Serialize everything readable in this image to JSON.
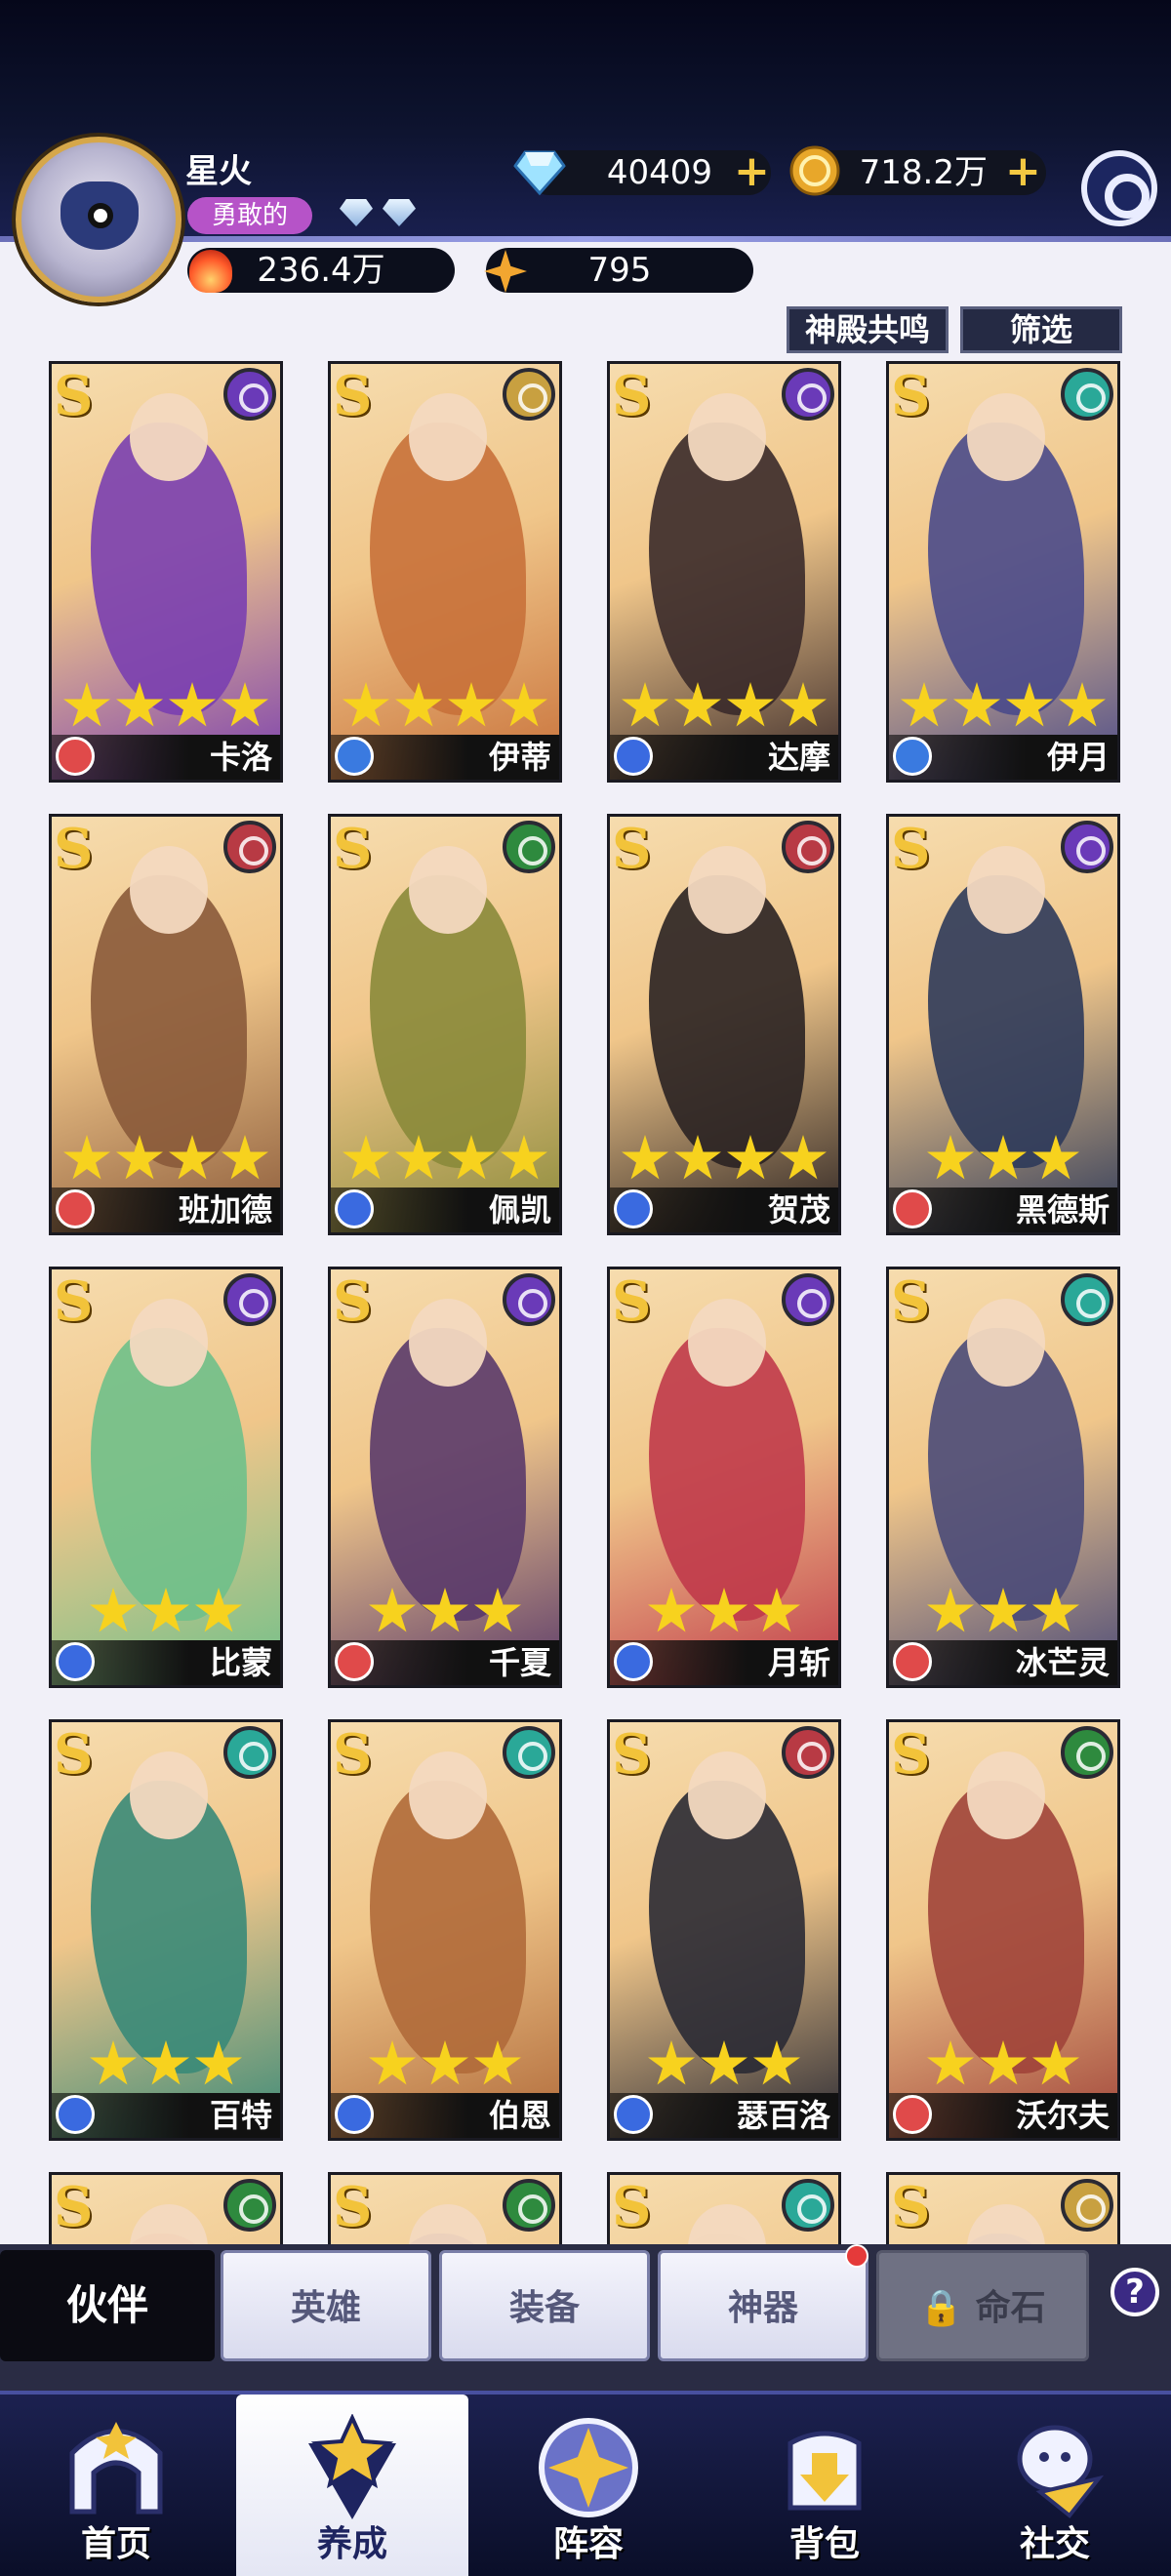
{
  "player": {
    "name": "星火",
    "title": "勇敢的",
    "power": "236.4万",
    "energy": "795"
  },
  "resources": {
    "diamonds": "40409",
    "gold": "718.2万"
  },
  "filters": {
    "resonance": "神殿共鸣",
    "filter": "筛选"
  },
  "heroes": [
    {
      "name": "卡洛",
      "stars": 4,
      "faction": "moon",
      "role": "sword",
      "color": "#7a3fb0"
    },
    {
      "name": "伊蒂",
      "stars": 4,
      "faction": "light",
      "role": "heal",
      "color": "#c8713a"
    },
    {
      "name": "达摩",
      "stars": 4,
      "faction": "moon",
      "role": "mage",
      "color": "#3a2a2a"
    },
    {
      "name": "伊月",
      "stars": 4,
      "faction": "nature",
      "role": "heal",
      "color": "#4a4a8a"
    },
    {
      "name": "班加德",
      "stars": 4,
      "faction": "fire",
      "role": "sword",
      "color": "#8a5a3a"
    },
    {
      "name": "佩凯",
      "stars": 4,
      "faction": "forest",
      "role": "shield",
      "color": "#8a8a3a"
    },
    {
      "name": "贺茂",
      "stars": 4,
      "faction": "fire",
      "role": "mage",
      "color": "#2a2222"
    },
    {
      "name": "黑德斯",
      "stars": 3,
      "faction": "moon",
      "role": "sword",
      "color": "#2e3a5a"
    },
    {
      "name": "比蒙",
      "stars": 3,
      "faction": "moon",
      "role": "shield",
      "color": "#6fc08a"
    },
    {
      "name": "千夏",
      "stars": 3,
      "faction": "moon",
      "role": "sword",
      "color": "#5a3a6a"
    },
    {
      "name": "月斩",
      "stars": 3,
      "faction": "moon",
      "role": "mage",
      "color": "#c03a4a"
    },
    {
      "name": "冰芒灵",
      "stars": 3,
      "faction": "nature",
      "role": "sword",
      "color": "#4a4a78"
    },
    {
      "name": "百特",
      "stars": 3,
      "faction": "nature",
      "role": "mage",
      "color": "#3a8a78"
    },
    {
      "name": "伯恩",
      "stars": 3,
      "faction": "nature",
      "role": "shield",
      "color": "#b06a3a"
    },
    {
      "name": "瑟百洛",
      "stars": 3,
      "faction": "fire",
      "role": "mage",
      "color": "#2a2a34"
    },
    {
      "name": "沃尔夫",
      "stars": 3,
      "faction": "forest",
      "role": "sword",
      "color": "#a0443a"
    },
    {
      "name": "",
      "stars": 0,
      "faction": "forest",
      "role": "",
      "color": "#e0704a"
    },
    {
      "name": "",
      "stars": 0,
      "faction": "forest",
      "role": "",
      "color": "#5a3a6a"
    },
    {
      "name": "",
      "stars": 0,
      "faction": "nature",
      "role": "",
      "color": "#e8c890"
    },
    {
      "name": "",
      "stars": 0,
      "faction": "light",
      "role": "",
      "color": "#6a6ab0"
    }
  ],
  "factionColors": {
    "moon": "#6a3ab8",
    "light": "#c8a040",
    "nature": "#2aa898",
    "fire": "#b83a44",
    "forest": "#2e8a3e"
  },
  "roleColors": {
    "sword": "#e04a4a",
    "heal": "#3a7ae0",
    "mage": "#3a6ae0",
    "shield": "#3a6ae0"
  },
  "tabs": {
    "partner": "伙伴",
    "hero": "英雄",
    "equipment": "装备",
    "artifact": "神器",
    "fatestone": "命石",
    "help": "?"
  },
  "nav": {
    "home": "首页",
    "train": "养成",
    "lineup": "阵容",
    "bag": "背包",
    "social": "社交"
  },
  "icons": {
    "gear": "gear-icon",
    "lock": "lock-icon",
    "diamond": "diamond-icon",
    "coin": "coin-icon"
  }
}
